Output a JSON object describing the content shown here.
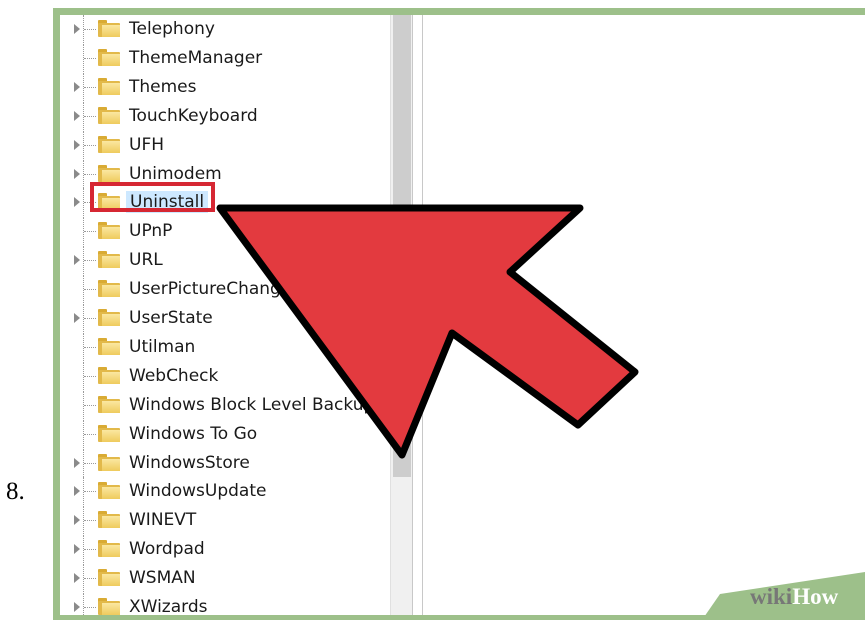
{
  "step_number": "8.",
  "tree": {
    "items": [
      {
        "label": "Telephony",
        "expandable": true
      },
      {
        "label": "ThemeManager",
        "expandable": false
      },
      {
        "label": "Themes",
        "expandable": true
      },
      {
        "label": "TouchKeyboard",
        "expandable": true
      },
      {
        "label": "UFH",
        "expandable": true
      },
      {
        "label": "Unimodem",
        "expandable": true
      },
      {
        "label": "Uninstall",
        "expandable": true,
        "selected": true
      },
      {
        "label": "UPnP",
        "expandable": false
      },
      {
        "label": "URL",
        "expandable": true
      },
      {
        "label": "UserPictureChang",
        "expandable": false
      },
      {
        "label": "UserState",
        "expandable": true
      },
      {
        "label": "Utilman",
        "expandable": false
      },
      {
        "label": "WebCheck",
        "expandable": false
      },
      {
        "label": "Windows Block Level Backup",
        "expandable": false
      },
      {
        "label": "Windows To Go",
        "expandable": false
      },
      {
        "label": "WindowsStore",
        "expandable": true
      },
      {
        "label": "WindowsUpdate",
        "expandable": true
      },
      {
        "label": "WINEVT",
        "expandable": true
      },
      {
        "label": "Wordpad",
        "expandable": true
      },
      {
        "label": "WSMAN",
        "expandable": true
      },
      {
        "label": "XWizards",
        "expandable": true
      }
    ]
  },
  "watermark": {
    "wiki": "wiki",
    "how": "How"
  },
  "colors": {
    "frame": "#9dc08a",
    "arrow": "#e33a3f",
    "highlight_box": "#d62733",
    "selection": "#cde8ff",
    "folder": "#e2b94a"
  }
}
